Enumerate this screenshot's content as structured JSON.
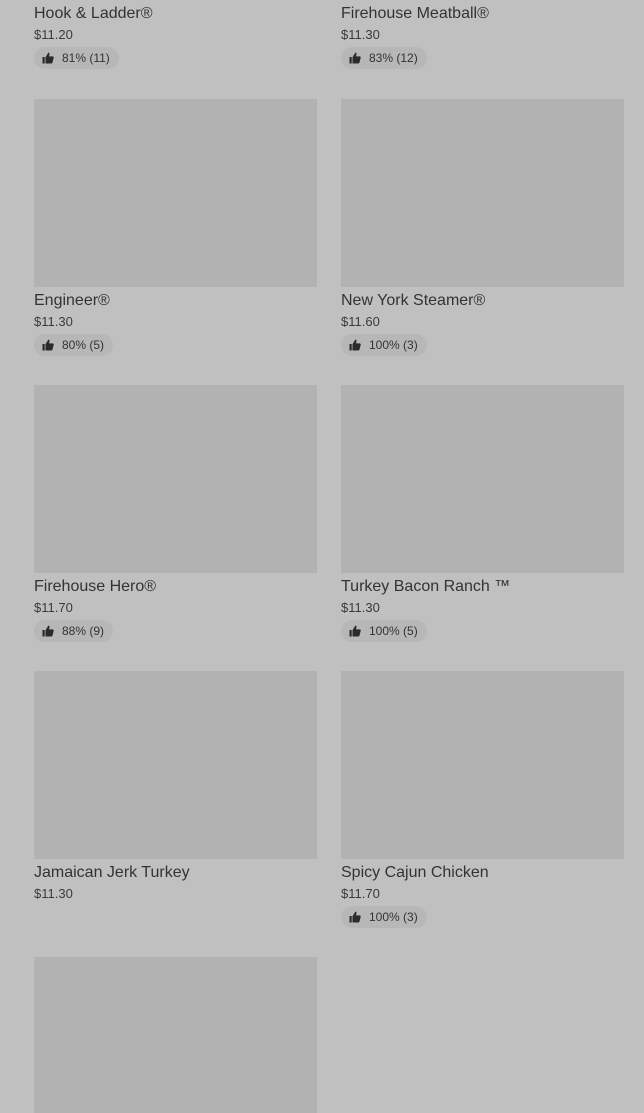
{
  "menu_items": [
    {
      "name": "Hook & Ladder®",
      "price": "$11.20",
      "rating": "81% (11)",
      "thumb_icon": "thumbs-up-icon"
    },
    {
      "name": "Firehouse Meatball®",
      "price": "$11.30",
      "rating": "83% (12)",
      "thumb_icon": "thumbs-up-icon"
    },
    {
      "name": "Engineer®",
      "price": "$11.30",
      "rating": "80% (5)",
      "thumb_icon": "thumbs-up-icon"
    },
    {
      "name": "New York Steamer®",
      "price": "$11.60",
      "rating": "100% (3)",
      "thumb_icon": "thumbs-up-icon"
    },
    {
      "name": "Firehouse Hero®",
      "price": "$11.70",
      "rating": "88% (9)",
      "thumb_icon": "thumbs-up-icon"
    },
    {
      "name": "Turkey Bacon Ranch ™",
      "price": "$11.30",
      "rating": "100% (5)",
      "thumb_icon": "thumbs-up-icon"
    },
    {
      "name": "Jamaican Jerk Turkey",
      "price": "$11.30",
      "rating": "",
      "thumb_icon": ""
    },
    {
      "name": "Spicy Cajun Chicken",
      "price": "$11.70",
      "rating": "100% (3)",
      "thumb_icon": "thumbs-up-icon"
    }
  ],
  "colors": {
    "background": "#c0c0c0",
    "image_placeholder": "#b2b2b2",
    "rating_pill": "#b7b7b7",
    "text": "#333333"
  }
}
